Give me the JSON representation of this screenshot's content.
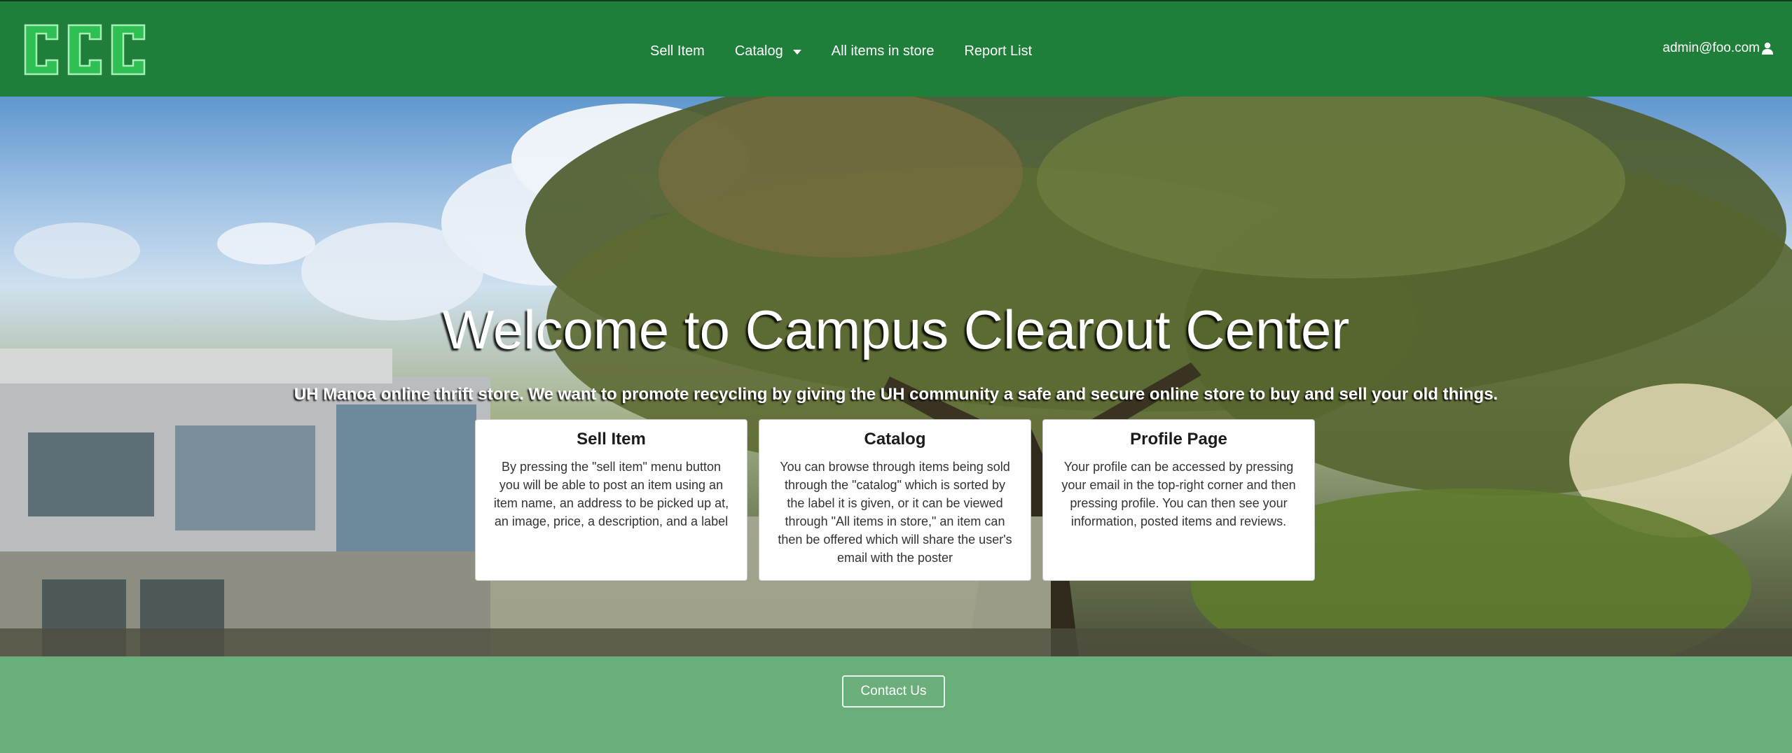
{
  "navbar": {
    "logo_text": "CCC",
    "links": [
      {
        "label": "Sell Item"
      },
      {
        "label": "Catalog"
      },
      {
        "label": "All items in store"
      },
      {
        "label": "Report List"
      }
    ],
    "user_email": "admin@foo.com"
  },
  "hero": {
    "title": "Welcome to Campus Clearout Center",
    "subtitle": "UH Manoa online thrift store. We want to promote recycling by giving the UH community a safe and secure online store to buy and sell your old things.",
    "cards": [
      {
        "title": "Sell Item",
        "text": "By pressing the \"sell item\" menu button you will be able to post an item using an item name, an address to be picked up at, an image, price, a description, and a label"
      },
      {
        "title": "Catalog",
        "text": "You can browse through items being sold through the \"catalog\" which is sorted by the label it is given, or it can be viewed through \"All items in store,\" an item can then be offered which will share the user's email with the poster"
      },
      {
        "title": "Profile Page",
        "text": "Your profile can be accessed by pressing your email in the top-right corner and then pressing profile. You can then see your information, posted items and reviews."
      }
    ]
  },
  "footer": {
    "contact_label": "Contact Us"
  },
  "colors": {
    "navbar_bg": "#1f7e3a",
    "footer_bg": "#6aaf7b",
    "logo_green": "#38c95a"
  },
  "icons": {
    "dropdown": "caret-down-icon",
    "user": "user-icon"
  }
}
